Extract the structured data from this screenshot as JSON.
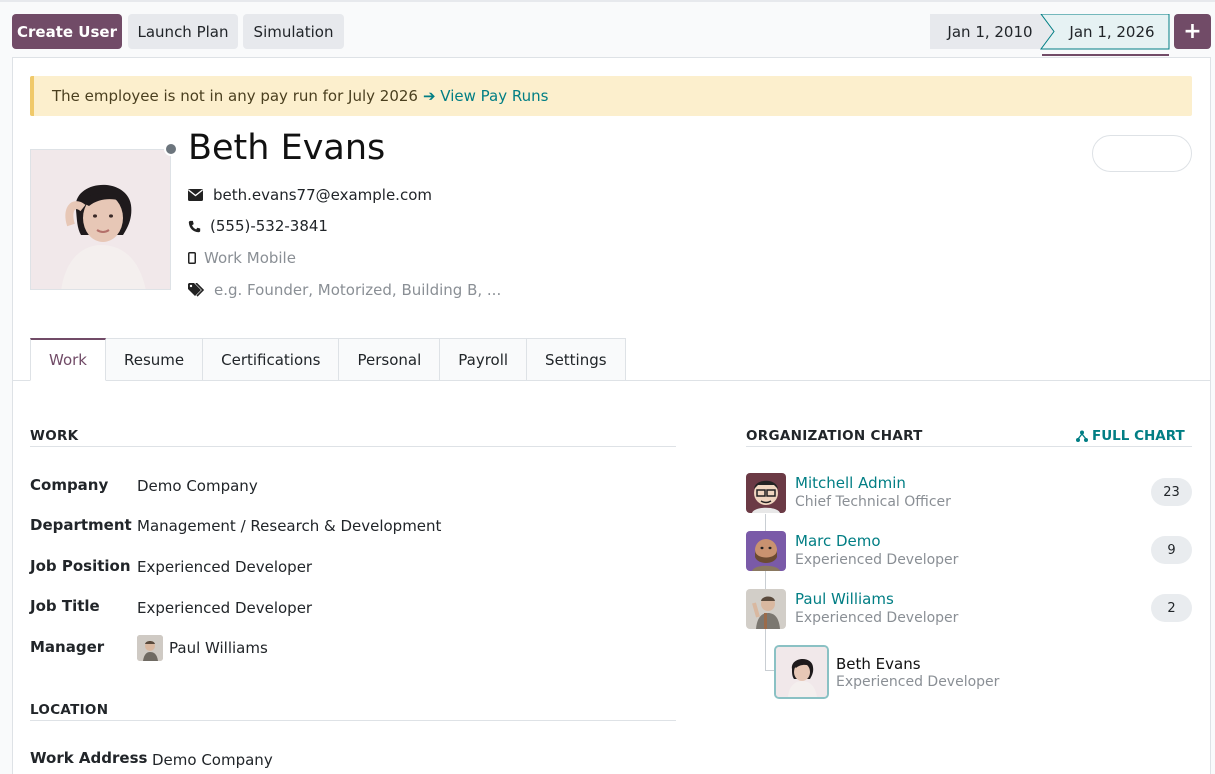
{
  "toolbar": {
    "create_user": "Create User",
    "launch_plan": "Launch Plan",
    "simulation": "Simulation",
    "date_from": "Jan 1, 2010",
    "date_to": "Jan 1, 2026",
    "add_icon": "plus-icon"
  },
  "alert": {
    "text": "The employee is not in any pay run for July 2026",
    "link": "➔ View Pay Runs"
  },
  "employee": {
    "name": "Beth Evans",
    "email": "beth.evans77@example.com",
    "phone": "(555)-532-3841",
    "mobile_placeholder": "Work Mobile",
    "tags_placeholder": "e.g. Founder, Motorized, Building B, ..."
  },
  "tabs": [
    "Work",
    "Resume",
    "Certifications",
    "Personal",
    "Payroll",
    "Settings"
  ],
  "work_section": {
    "title": "WORK",
    "fields": [
      {
        "label": "Company",
        "value": "Demo Company"
      },
      {
        "label": "Department",
        "value": "Management / Research & Development"
      },
      {
        "label": "Job Position",
        "value": "Experienced Developer"
      },
      {
        "label": "Job Title",
        "value": "Experienced Developer"
      },
      {
        "label": "Manager",
        "value": "Paul Williams"
      }
    ]
  },
  "location_section": {
    "title": "LOCATION",
    "fields": [
      {
        "label": "Work Address",
        "value": "Demo Company"
      }
    ]
  },
  "org_chart": {
    "title": "ORGANIZATION CHART",
    "full_chart": "FULL CHART",
    "managers": [
      {
        "name": "Mitchell Admin",
        "job": "Chief Technical Officer",
        "count": "23"
      },
      {
        "name": "Marc Demo",
        "job": "Experienced Developer",
        "count": "9"
      },
      {
        "name": "Paul Williams",
        "job": "Experienced Developer",
        "count": "2"
      }
    ],
    "self": {
      "name": "Beth Evans",
      "job": "Experienced Developer"
    }
  },
  "colors": {
    "brand": "#714b67",
    "link": "#017e84",
    "alert_bg": "#fcefcd"
  }
}
